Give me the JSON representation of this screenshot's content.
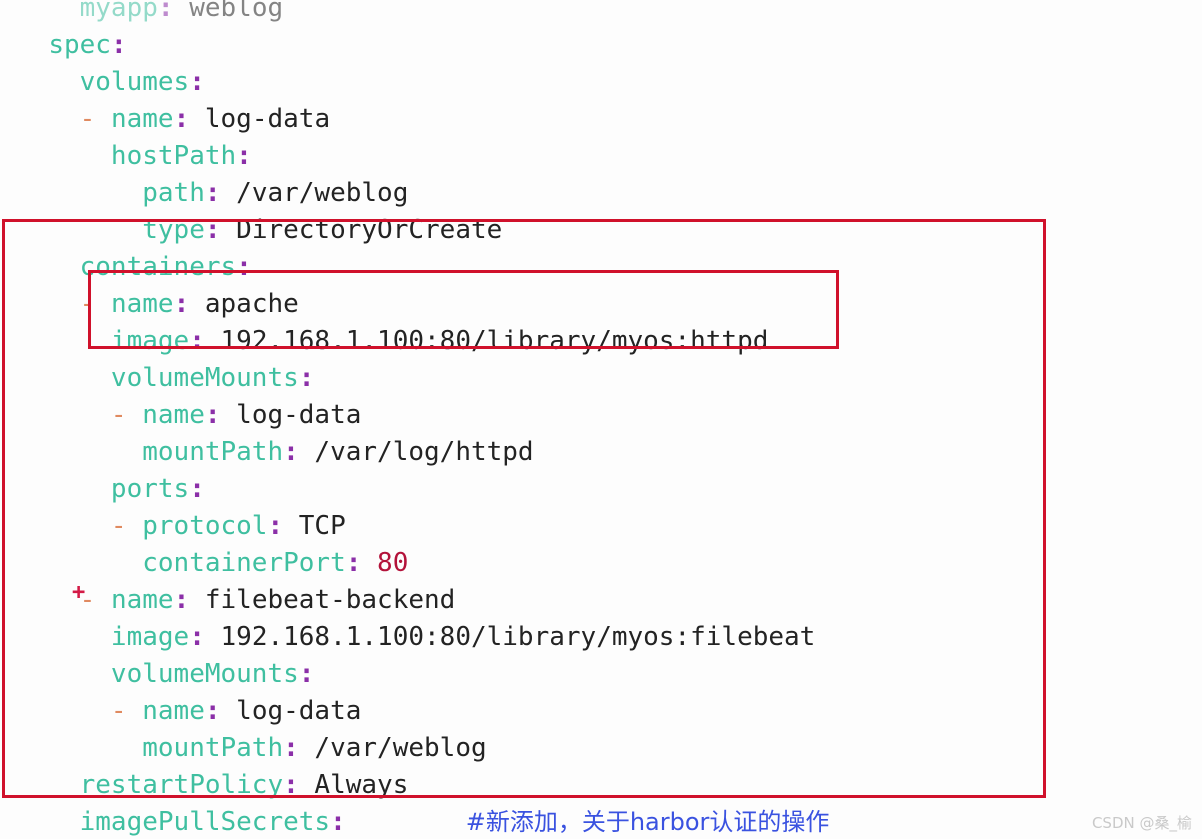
{
  "editor": {
    "language": "yaml",
    "background_color": "#fdfdfd",
    "key_color": "#3fbfa0",
    "colon_color": "#8b2fa8",
    "value_color": "#232323",
    "dash_color": "#e08a60",
    "number_color": "#b3123a",
    "comment_color": "#3a52e0",
    "lines": [
      {
        "indent": "    ",
        "dash": "",
        "key": "myapp",
        "value": "weblog",
        "clipped": true
      },
      {
        "indent": "  ",
        "dash": "",
        "key": "spec",
        "value": ""
      },
      {
        "indent": "    ",
        "dash": "",
        "key": "volumes",
        "value": ""
      },
      {
        "indent": "    ",
        "dash": "- ",
        "key": "name",
        "value": "log-data"
      },
      {
        "indent": "      ",
        "dash": "",
        "key": "hostPath",
        "value": ""
      },
      {
        "indent": "        ",
        "dash": "",
        "key": "path",
        "value": "/var/weblog"
      },
      {
        "indent": "        ",
        "dash": "",
        "key": "type",
        "value": "DirectoryOrCreate"
      },
      {
        "indent": "    ",
        "dash": "",
        "key": "containers",
        "value": ""
      },
      {
        "indent": "    ",
        "dash": "- ",
        "key": "name",
        "value": "apache"
      },
      {
        "indent": "      ",
        "dash": "",
        "key": "image",
        "value": "192.168.1.100:80/library/myos:httpd"
      },
      {
        "indent": "      ",
        "dash": "",
        "key": "volumeMounts",
        "value": ""
      },
      {
        "indent": "      ",
        "dash": "- ",
        "key": "name",
        "value": "log-data"
      },
      {
        "indent": "        ",
        "dash": "",
        "key": "mountPath",
        "value": "/var/log/httpd"
      },
      {
        "indent": "      ",
        "dash": "",
        "key": "ports",
        "value": ""
      },
      {
        "indent": "      ",
        "dash": "- ",
        "key": "protocol",
        "value": "TCP"
      },
      {
        "indent": "        ",
        "dash": "",
        "key": "containerPort",
        "value": "80",
        "value_is_number": true
      },
      {
        "indent": "    ",
        "dash": "- ",
        "key": "name",
        "value": "filebeat-backend",
        "gutter": "+"
      },
      {
        "indent": "      ",
        "dash": "",
        "key": "image",
        "value": "192.168.1.100:80/library/myos:filebeat"
      },
      {
        "indent": "      ",
        "dash": "",
        "key": "volumeMounts",
        "value": ""
      },
      {
        "indent": "      ",
        "dash": "- ",
        "key": "name",
        "value": "log-data"
      },
      {
        "indent": "        ",
        "dash": "",
        "key": "mountPath",
        "value": "/var/weblog"
      },
      {
        "indent": "    ",
        "dash": "",
        "key": "restartPolicy",
        "value": "Always"
      },
      {
        "indent": "    ",
        "dash": "",
        "key": "imagePullSecrets",
        "value": "",
        "comment": "#新添加，关于harbor认证的操作"
      }
    ]
  },
  "annotations": {
    "outer_box": {
      "label": "containers-block-highlight",
      "color": "#d0112b"
    },
    "inner_box": {
      "label": "apache-container-highlight",
      "color": "#d0112b"
    }
  },
  "watermark": {
    "text": "CSDN @桑_榆"
  }
}
